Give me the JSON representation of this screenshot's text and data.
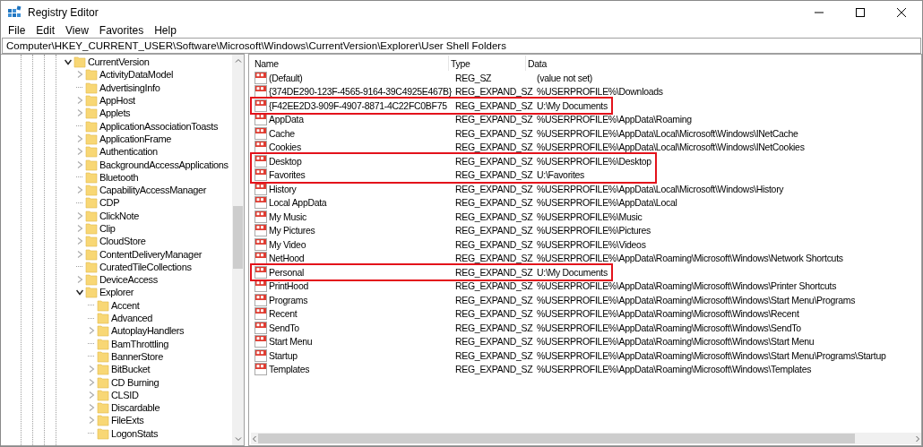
{
  "window": {
    "title": "Registry Editor"
  },
  "menu": [
    "File",
    "Edit",
    "View",
    "Favorites",
    "Help"
  ],
  "address": "Computer\\HKEY_CURRENT_USER\\Software\\Microsoft\\Windows\\CurrentVersion\\Explorer\\User Shell Folders",
  "tree": {
    "label": "CurrentVersion",
    "expandable": true,
    "expanded": true,
    "children": [
      {
        "label": "ActivityDataModel",
        "expandable": true,
        "expanded": false
      },
      {
        "label": "AdvertisingInfo",
        "expandable": false
      },
      {
        "label": "AppHost",
        "expandable": true,
        "expanded": false
      },
      {
        "label": "Applets",
        "expandable": true,
        "expanded": false
      },
      {
        "label": "ApplicationAssociationToasts",
        "expandable": false
      },
      {
        "label": "ApplicationFrame",
        "expandable": true,
        "expanded": false
      },
      {
        "label": "Authentication",
        "expandable": true,
        "expanded": false
      },
      {
        "label": "BackgroundAccessApplications",
        "expandable": true,
        "expanded": false
      },
      {
        "label": "Bluetooth",
        "expandable": false
      },
      {
        "label": "CapabilityAccessManager",
        "expandable": true,
        "expanded": false
      },
      {
        "label": "CDP",
        "expandable": false
      },
      {
        "label": "ClickNote",
        "expandable": true,
        "expanded": false
      },
      {
        "label": "Clip",
        "expandable": true,
        "expanded": false
      },
      {
        "label": "CloudStore",
        "expandable": true,
        "expanded": false
      },
      {
        "label": "ContentDeliveryManager",
        "expandable": true,
        "expanded": false
      },
      {
        "label": "CuratedTileCollections",
        "expandable": false
      },
      {
        "label": "DeviceAccess",
        "expandable": true,
        "expanded": false
      },
      {
        "label": "Explorer",
        "expandable": true,
        "expanded": true,
        "children": [
          {
            "label": "Accent",
            "expandable": false
          },
          {
            "label": "Advanced",
            "expandable": false
          },
          {
            "label": "AutoplayHandlers",
            "expandable": true,
            "expanded": false
          },
          {
            "label": "BamThrottling",
            "expandable": false
          },
          {
            "label": "BannerStore",
            "expandable": false
          },
          {
            "label": "BitBucket",
            "expandable": true,
            "expanded": false
          },
          {
            "label": "CD Burning",
            "expandable": true,
            "expanded": false
          },
          {
            "label": "CLSID",
            "expandable": true,
            "expanded": false
          },
          {
            "label": "Discardable",
            "expandable": true,
            "expanded": false
          },
          {
            "label": "FileExts",
            "expandable": true,
            "expanded": false
          },
          {
            "label": "LogonStats",
            "expandable": false
          }
        ]
      }
    ]
  },
  "columns": [
    "Name",
    "Type",
    "Data"
  ],
  "rows": [
    {
      "name": "(Default)",
      "type": "REG_SZ",
      "data": "(value not set)",
      "highlighted": false
    },
    {
      "name": "{374DE290-123F-4565-9164-39C4925E467B}",
      "type": "REG_EXPAND_SZ",
      "data": "%USERPROFILE%\\Downloads",
      "highlighted": false
    },
    {
      "name": "{F42EE2D3-909F-4907-8871-4C22FC0BF75",
      "type": "REG_EXPAND_SZ",
      "data": "U:\\My Documents",
      "highlighted": true
    },
    {
      "name": "AppData",
      "type": "REG_EXPAND_SZ",
      "data": "%USERPROFILE%\\AppData\\Roaming",
      "highlighted": false
    },
    {
      "name": "Cache",
      "type": "REG_EXPAND_SZ",
      "data": "%USERPROFILE%\\AppData\\Local\\Microsoft\\Windows\\INetCache",
      "highlighted": false
    },
    {
      "name": "Cookies",
      "type": "REG_EXPAND_SZ",
      "data": "%USERPROFILE%\\AppData\\Local\\Microsoft\\Windows\\INetCookies",
      "highlighted": false
    },
    {
      "name": "Desktop",
      "type": "REG_EXPAND_SZ",
      "data": "%USERPROFILE%\\Desktop",
      "highlighted": true
    },
    {
      "name": "Favorites",
      "type": "REG_EXPAND_SZ",
      "data": "U:\\Favorites",
      "highlighted": true
    },
    {
      "name": "History",
      "type": "REG_EXPAND_SZ",
      "data": "%USERPROFILE%\\AppData\\Local\\Microsoft\\Windows\\History",
      "highlighted": false
    },
    {
      "name": "Local AppData",
      "type": "REG_EXPAND_SZ",
      "data": "%USERPROFILE%\\AppData\\Local",
      "highlighted": false
    },
    {
      "name": "My Music",
      "type": "REG_EXPAND_SZ",
      "data": "%USERPROFILE%\\Music",
      "highlighted": false
    },
    {
      "name": "My Pictures",
      "type": "REG_EXPAND_SZ",
      "data": "%USERPROFILE%\\Pictures",
      "highlighted": false
    },
    {
      "name": "My Video",
      "type": "REG_EXPAND_SZ",
      "data": "%USERPROFILE%\\Videos",
      "highlighted": false
    },
    {
      "name": "NetHood",
      "type": "REG_EXPAND_SZ",
      "data": "%USERPROFILE%\\AppData\\Roaming\\Microsoft\\Windows\\Network Shortcuts",
      "highlighted": false
    },
    {
      "name": "Personal",
      "type": "REG_EXPAND_SZ",
      "data": "U:\\My Documents",
      "highlighted": true
    },
    {
      "name": "PrintHood",
      "type": "REG_EXPAND_SZ",
      "data": "%USERPROFILE%\\AppData\\Roaming\\Microsoft\\Windows\\Printer Shortcuts",
      "highlighted": false
    },
    {
      "name": "Programs",
      "type": "REG_EXPAND_SZ",
      "data": "%USERPROFILE%\\AppData\\Roaming\\Microsoft\\Windows\\Start Menu\\Programs",
      "highlighted": false
    },
    {
      "name": "Recent",
      "type": "REG_EXPAND_SZ",
      "data": "%USERPROFILE%\\AppData\\Roaming\\Microsoft\\Windows\\Recent",
      "highlighted": false
    },
    {
      "name": "SendTo",
      "type": "REG_EXPAND_SZ",
      "data": "%USERPROFILE%\\AppData\\Roaming\\Microsoft\\Windows\\SendTo",
      "highlighted": false
    },
    {
      "name": "Start Menu",
      "type": "REG_EXPAND_SZ",
      "data": "%USERPROFILE%\\AppData\\Roaming\\Microsoft\\Windows\\Start Menu",
      "highlighted": false
    },
    {
      "name": "Startup",
      "type": "REG_EXPAND_SZ",
      "data": "%USERPROFILE%\\AppData\\Roaming\\Microsoft\\Windows\\Start Menu\\Programs\\Startup",
      "highlighted": false
    },
    {
      "name": "Templates",
      "type": "REG_EXPAND_SZ",
      "data": "%USERPROFILE%\\AppData\\Roaming\\Microsoft\\Windows\\Templates",
      "highlighted": false
    }
  ]
}
